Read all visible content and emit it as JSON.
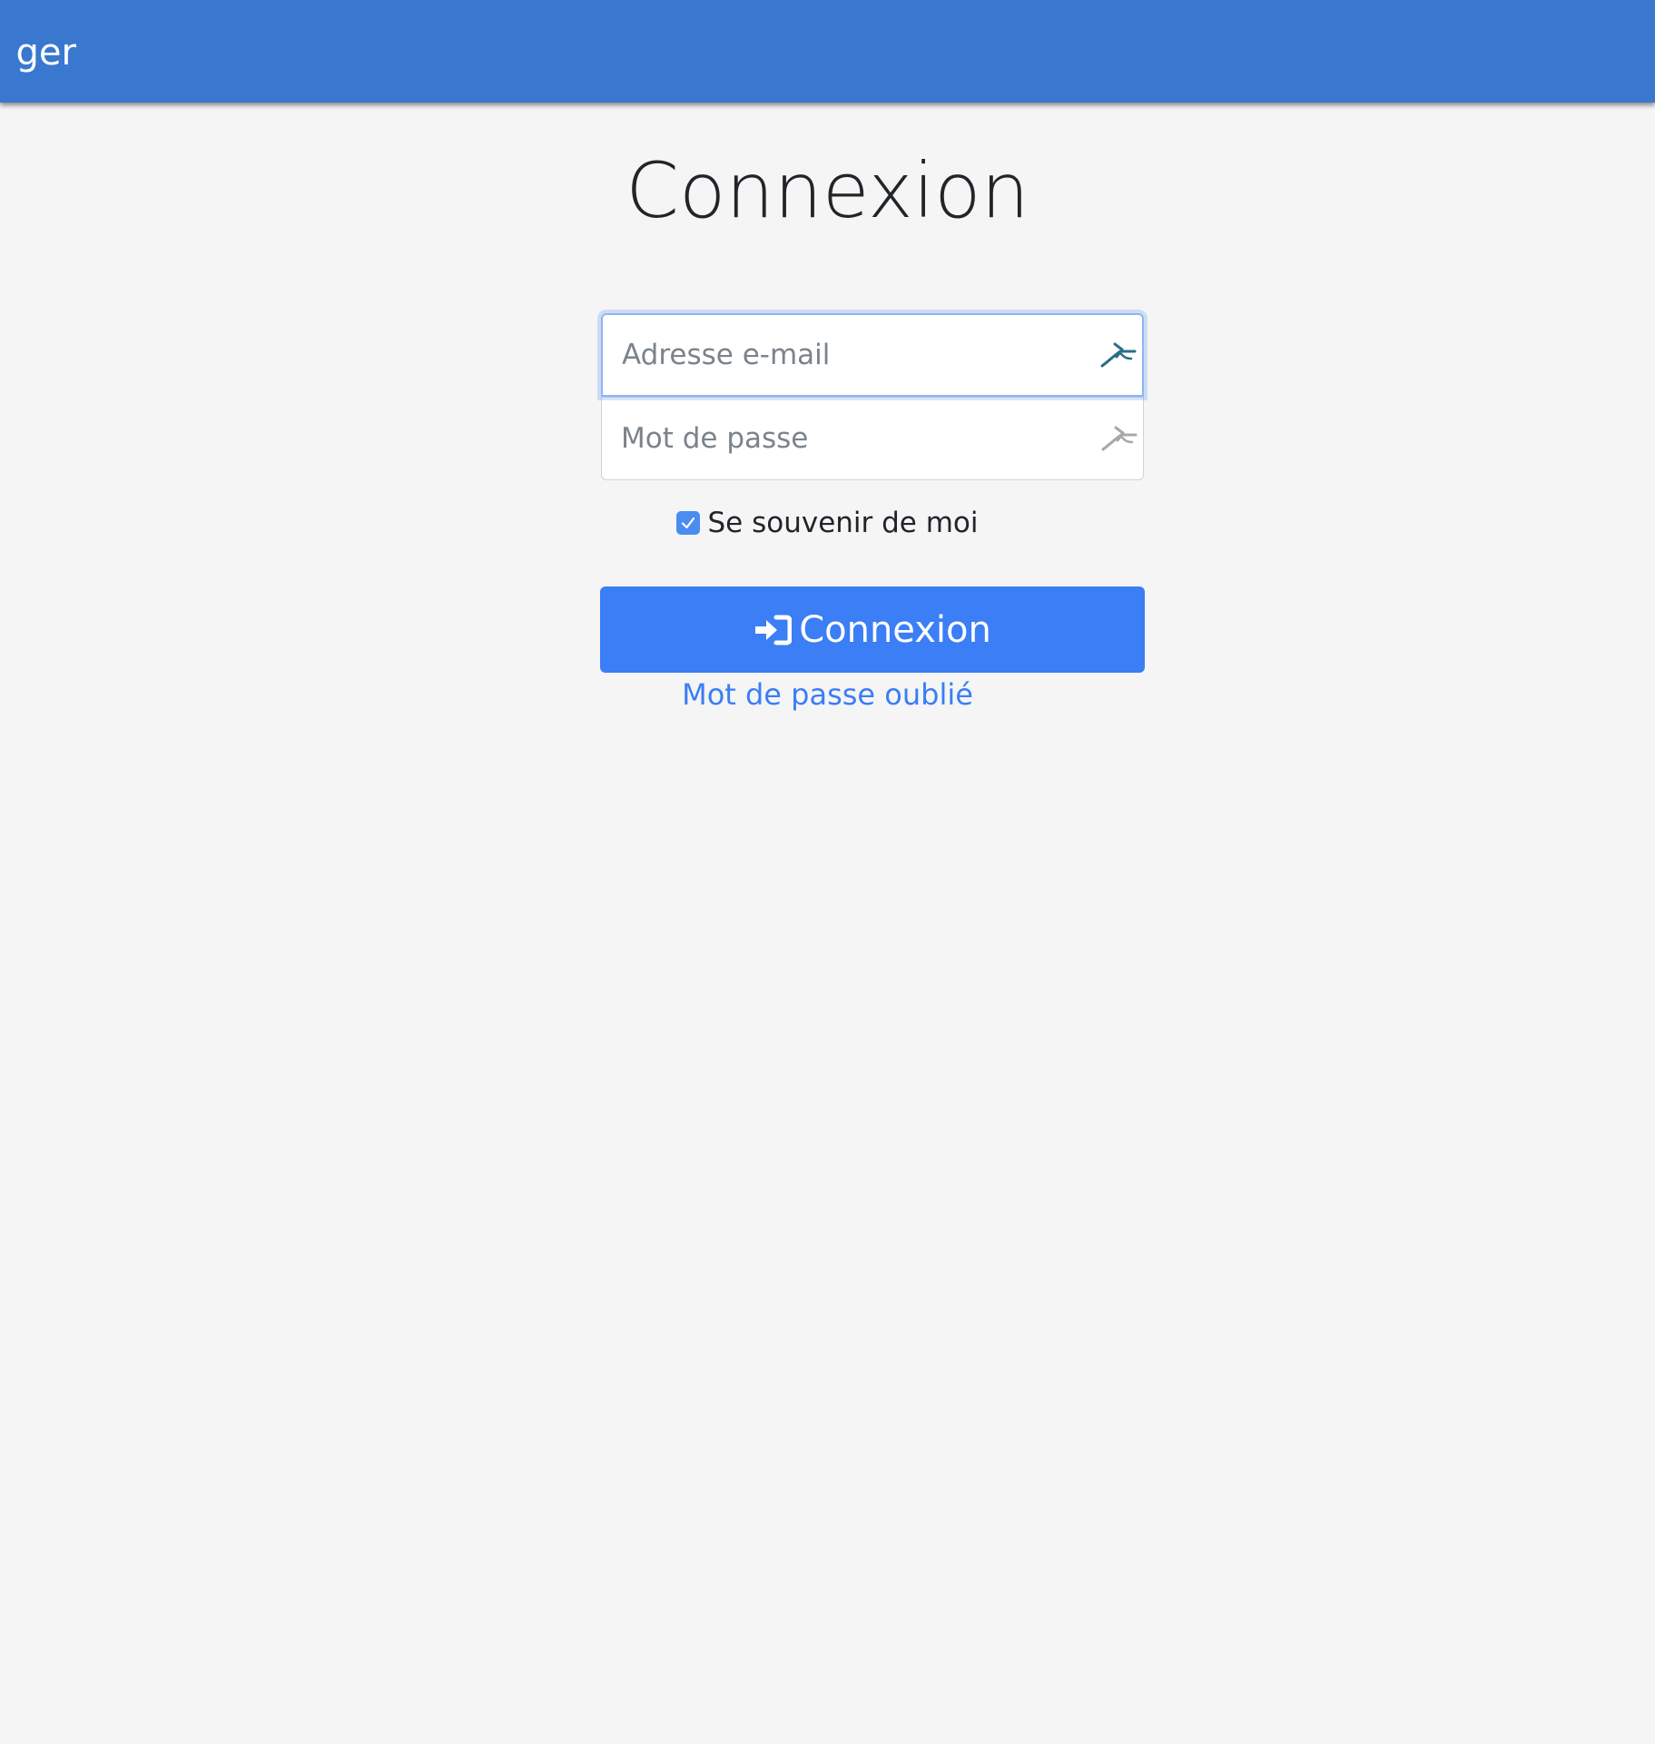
{
  "navbar": {
    "brand": "ger"
  },
  "page": {
    "title": "Connexion"
  },
  "form": {
    "email": {
      "value": "",
      "placeholder": "Adresse e-mail",
      "autofill_icon": "password-manager-icon"
    },
    "password": {
      "value": "",
      "placeholder": "Mot de passe",
      "autofill_icon": "password-manager-icon"
    },
    "remember": {
      "label": "Se souvenir de moi",
      "checked": true
    },
    "submit": {
      "label": "Connexion",
      "icon": "sign-in-icon"
    },
    "forgot_link": "Mot de passe oublié"
  },
  "colors": {
    "navbar": "#3a78cf",
    "primary": "#3b7ef5",
    "background": "#f5f5f5",
    "focus_border": "#8fb6f2"
  }
}
